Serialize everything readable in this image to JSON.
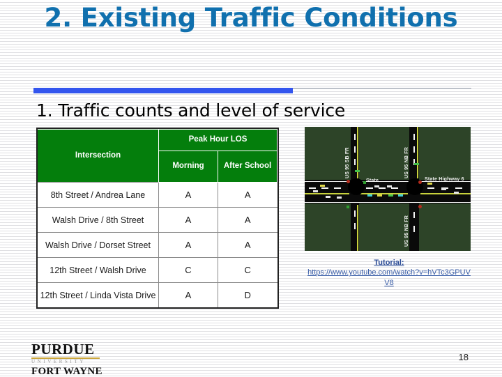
{
  "slide": {
    "title": "2. Existing Traffic Conditions",
    "page_number": "18",
    "accent_blue": "#3355EE",
    "title_blue": "#1070AE",
    "header_green": "#047E0C"
  },
  "bullet": {
    "text": "1. Traffic counts and level of service"
  },
  "table": {
    "col_intersection": "Intersection",
    "col_group": "Peak Hour LOS",
    "col_morning": "Morning",
    "col_after_school": "After School",
    "rows": [
      {
        "intersection": "8th Street / Andrea Lane",
        "morning": "A",
        "after_school": "A"
      },
      {
        "intersection": "Walsh Drive / 8th Street",
        "morning": "A",
        "after_school": "A"
      },
      {
        "intersection": "Walsh Drive / Dorset Street",
        "morning": "A",
        "after_school": "A"
      },
      {
        "intersection": "12th Street / Walsh Drive",
        "morning": "C",
        "after_school": "C"
      },
      {
        "intersection": "12th Street / Linda Vista Drive",
        "morning": "A",
        "after_school": "D"
      }
    ]
  },
  "diagram": {
    "labels": {
      "left_vertical": "US 95 SB FR",
      "right_vertical": "US 95 NB FR",
      "bottom_vertical": "US 95 NB FR",
      "state": "State",
      "highway": "State Highway 6"
    }
  },
  "tutorial": {
    "label": "Tutorial:",
    "url_line1": "https://www.youtube.com/watch?v=hVTc3GPUV",
    "url_line2": "V8"
  },
  "logo": {
    "purdue": "PURDUE",
    "university": "UNIVERSITY",
    "fort_wayne": "FORT WAYNE"
  }
}
